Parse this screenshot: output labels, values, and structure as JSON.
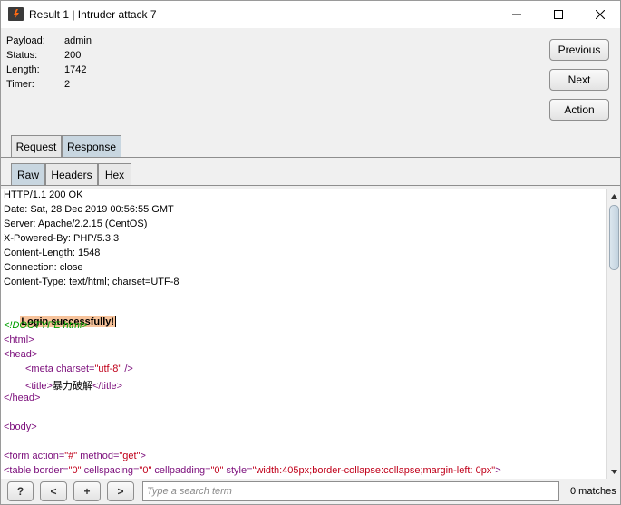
{
  "window": {
    "title": "Result 1 | Intruder attack 7"
  },
  "info": [
    {
      "key": "Payload:",
      "value": "admin"
    },
    {
      "key": "Status:",
      "value": "200"
    },
    {
      "key": "Length:",
      "value": "1742"
    },
    {
      "key": "Timer:",
      "value": "2"
    }
  ],
  "buttons": {
    "previous": "Previous",
    "next": "Next",
    "action": "Action"
  },
  "tabs": {
    "request": "Request",
    "response": "Response",
    "active": "Response"
  },
  "subtabs": {
    "raw": "Raw",
    "headers": "Headers",
    "hex": "Hex",
    "active": "Raw"
  },
  "response": {
    "headers": [
      "HTTP/1.1 200 OK",
      "Date: Sat, 28 Dec 2019 00:56:55 GMT",
      "Server: Apache/2.2.15 (CentOS)",
      "X-Powered-By: PHP/5.3.3",
      "Content-Length: 1548",
      "Connection: close",
      "Content-Type: text/html; charset=UTF-8"
    ],
    "highlight": "Login successfully!",
    "doctype": "<!DOCTYPE html>",
    "html_open": "<html>",
    "head_open": "<head>",
    "meta_tag_open": "<meta ",
    "meta_attr": "charset=",
    "meta_val": "\"utf-8\"",
    "meta_close": " />",
    "title_open": "<title>",
    "title_text": "暴力破解",
    "title_close": "</title>",
    "head_close": "</head>",
    "body_open": "<body>",
    "form_tag": "<form ",
    "form_attr1": "action=",
    "form_val1": "\"#\"",
    "form_attr2": " method=",
    "form_val2": "\"get\"",
    "form_end": ">",
    "table_tag": "<table ",
    "table_a1": "border=",
    "table_v1": "\"0\"",
    "table_a2": " cellspacing=",
    "table_v2": "\"0\"",
    "table_a3": " cellpadding=",
    "table_v3": "\"0\"",
    "table_a4": " style=",
    "table_v4": "\"width:405px;border-collapse:collapse;margin-left: 0px\"",
    "table_end": ">"
  },
  "footer": {
    "help": "?",
    "prev": "<",
    "add": "+",
    "next": ">",
    "search_placeholder": "Type a search term",
    "matches": "0 matches"
  },
  "colors": {
    "highlight": "#f7c39b",
    "tag": "#7b0d7b",
    "attr_value": "#c0001a",
    "doctype": "#00a000",
    "active_tab": "#c8d6e0"
  }
}
